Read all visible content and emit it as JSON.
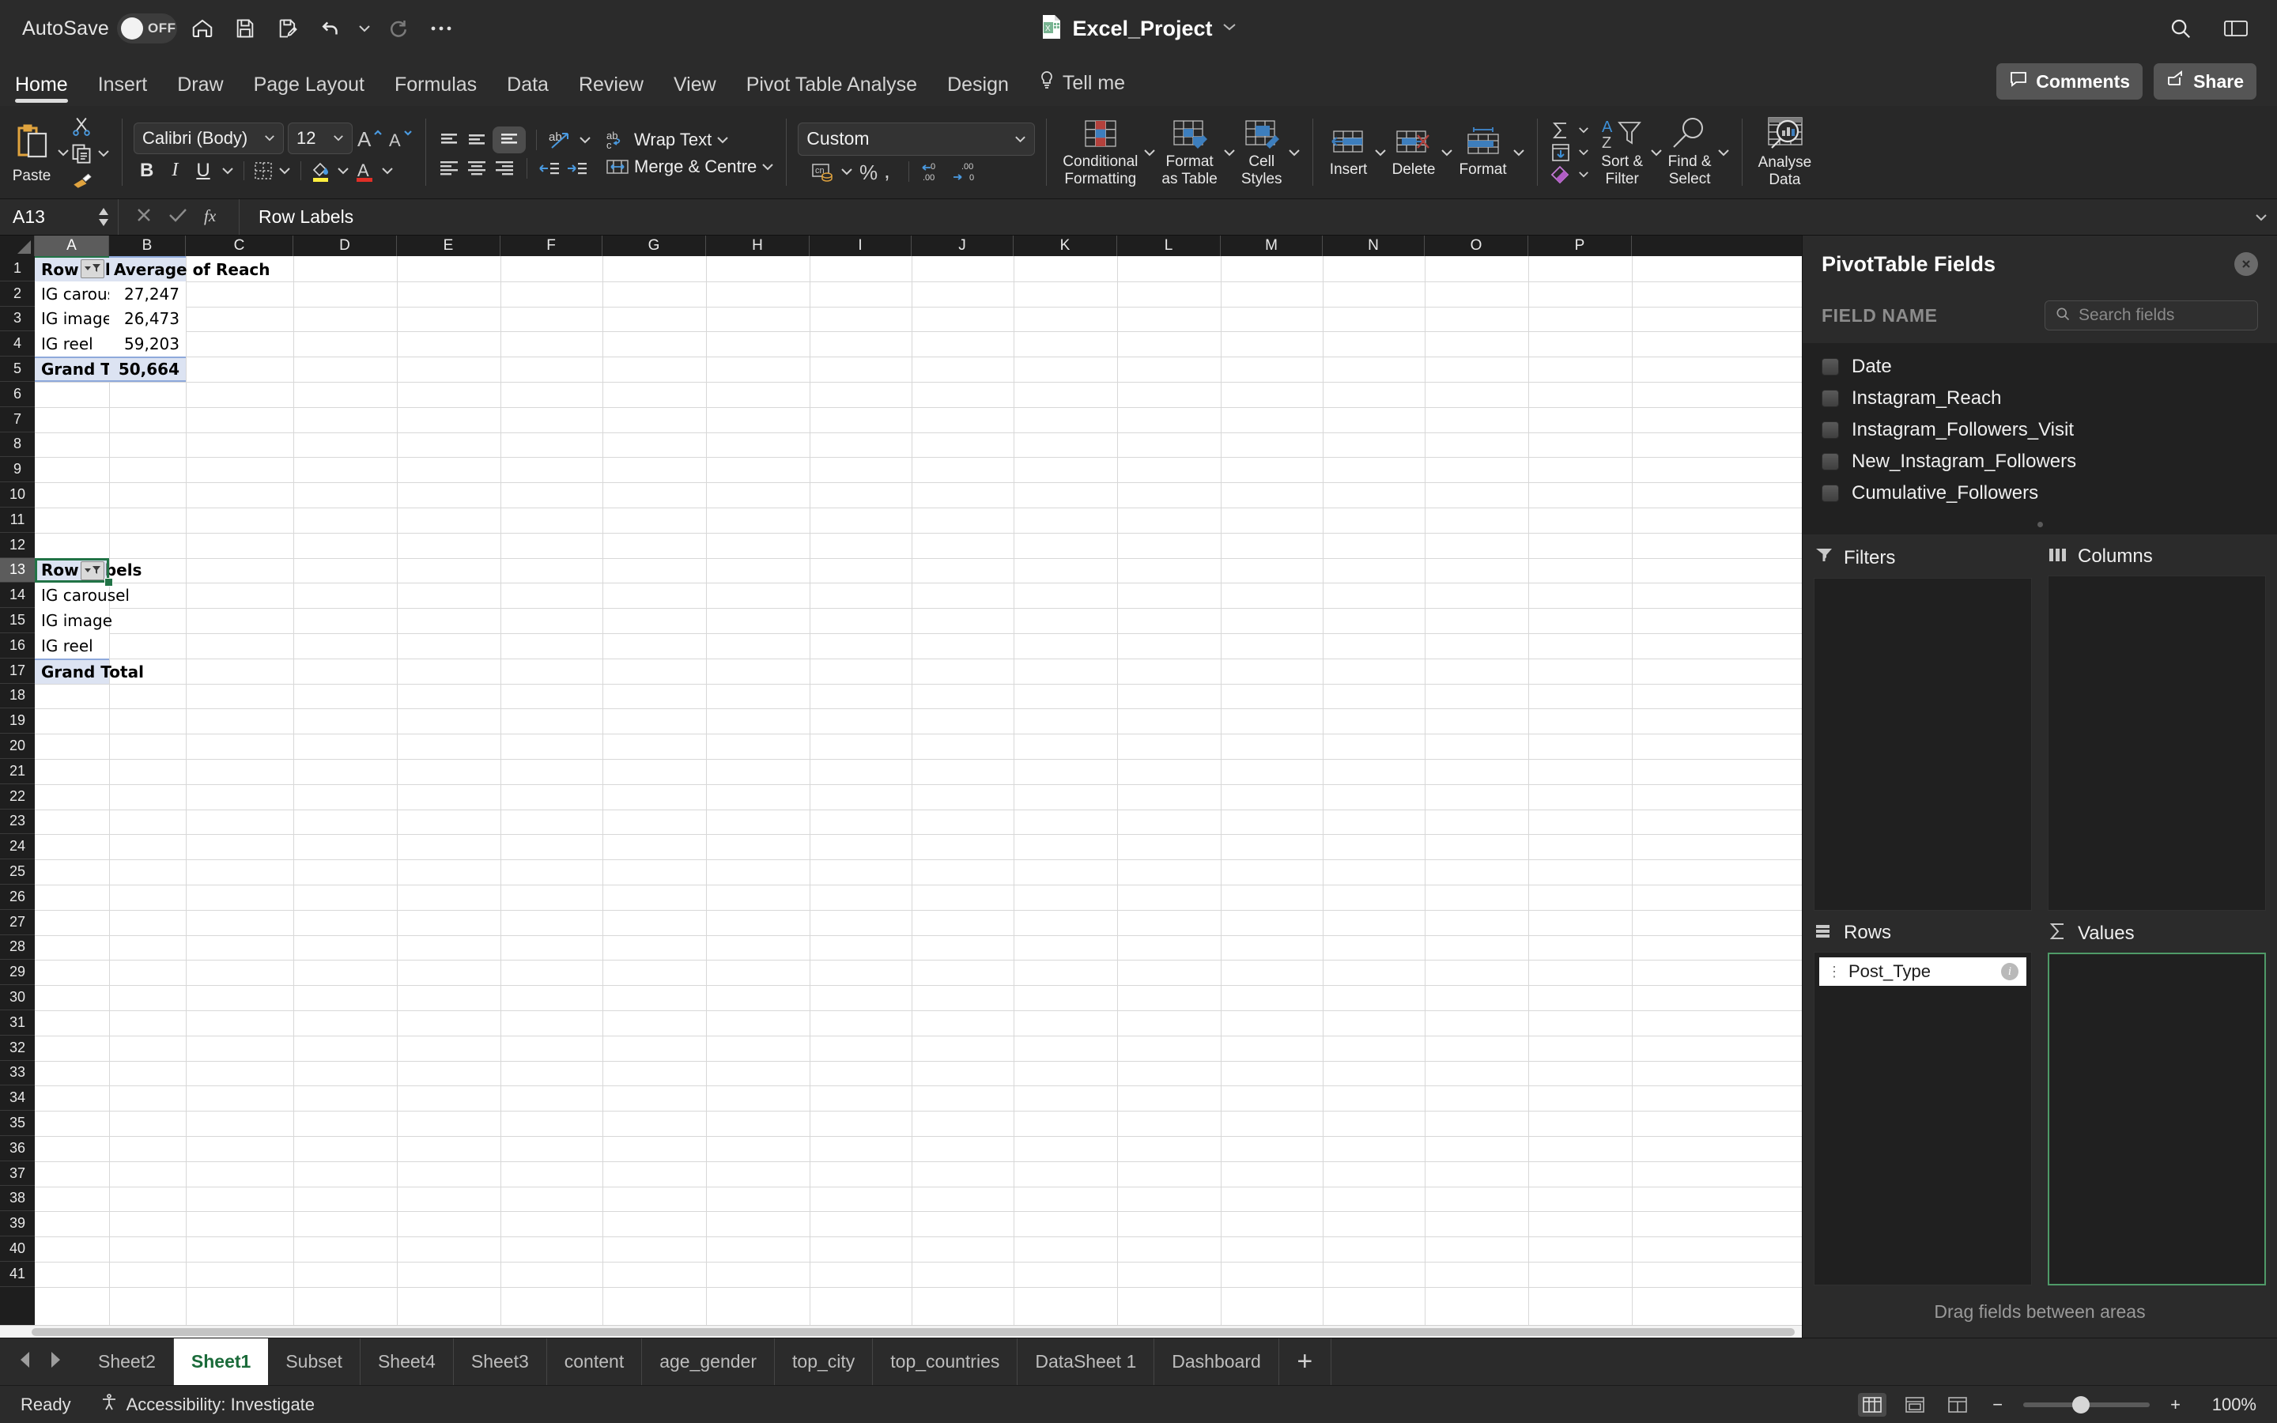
{
  "titlebar": {
    "autosave_label": "AutoSave",
    "autosave_state": "OFF",
    "doc_title": "Excel_Project",
    "icons": [
      "home-icon",
      "save-icon",
      "save-as-icon",
      "undo-icon",
      "redo-icon",
      "more-icon",
      "search-icon",
      "ribbon-display-icon"
    ]
  },
  "tabs": {
    "items": [
      {
        "label": "Home",
        "active": true
      },
      {
        "label": "Insert",
        "active": false
      },
      {
        "label": "Draw",
        "active": false
      },
      {
        "label": "Page Layout",
        "active": false
      },
      {
        "label": "Formulas",
        "active": false
      },
      {
        "label": "Data",
        "active": false
      },
      {
        "label": "Review",
        "active": false
      },
      {
        "label": "View",
        "active": false
      },
      {
        "label": "Pivot Table Analyse",
        "active": false
      },
      {
        "label": "Design",
        "active": false
      },
      {
        "label": "Tell me",
        "active": false
      }
    ],
    "comments_label": "Comments",
    "share_label": "Share"
  },
  "ribbon": {
    "paste_label": "Paste",
    "font_name": "Calibri (Body)",
    "font_size": "12",
    "bold": "B",
    "italic": "I",
    "underline": "U",
    "wrap_text_label": "Wrap Text",
    "merge_label": "Merge & Centre",
    "number_format": "Custom",
    "conditional_formatting": "Conditional\nFormatting",
    "conditional_formatting_l1": "Conditional",
    "conditional_formatting_l2": "Formatting",
    "format_as_table_l1": "Format",
    "format_as_table_l2": "as Table",
    "cell_styles_l1": "Cell",
    "cell_styles_l2": "Styles",
    "insert_label": "Insert",
    "delete_label": "Delete",
    "format_label": "Format",
    "sort_filter_l1": "Sort &",
    "sort_filter_l2": "Filter",
    "find_select_l1": "Find &",
    "find_select_l2": "Select",
    "analyse_data_l1": "Analyse",
    "analyse_data_l2": "Data"
  },
  "formula_bar": {
    "name_box": "A13",
    "formula_value": "Row Labels"
  },
  "grid": {
    "columns": [
      "A",
      "B",
      "C",
      "D",
      "E",
      "F",
      "G",
      "H",
      "I",
      "J",
      "K",
      "L",
      "M",
      "N",
      "O",
      "P"
    ],
    "selected_column": "A",
    "rows": [
      1,
      2,
      3,
      4,
      5,
      6,
      7,
      8,
      9,
      10,
      11,
      12,
      13,
      14,
      15,
      16,
      17,
      18,
      19,
      20,
      21,
      22,
      23,
      24,
      25,
      26,
      27,
      28,
      29,
      30,
      31,
      32,
      33,
      34,
      35,
      36,
      37,
      38,
      39,
      40,
      41
    ],
    "selected_row": 13,
    "pivot_table_1": {
      "header": [
        "Row Labels",
        "Average of Reach"
      ],
      "rows": [
        {
          "label": "IG carousel",
          "value": "27,247"
        },
        {
          "label": "IG image",
          "value": "26,473"
        },
        {
          "label": "IG reel",
          "value": "59,203"
        }
      ],
      "total": {
        "label": "Grand Total",
        "value": "50,664"
      }
    },
    "pivot_table_2": {
      "header": [
        "Row Labels"
      ],
      "rows": [
        {
          "label": "IG carousel"
        },
        {
          "label": "IG image"
        },
        {
          "label": "IG reel"
        }
      ],
      "total": {
        "label": "Grand Total"
      }
    }
  },
  "pivot_panel": {
    "title": "PivotTable Fields",
    "field_name_label": "FIELD NAME",
    "search_placeholder": "Search fields",
    "search_value": "",
    "fields": [
      {
        "label": "Date",
        "checked": false
      },
      {
        "label": "Instagram_Reach",
        "checked": false
      },
      {
        "label": "Instagram_Followers_Visit",
        "checked": false
      },
      {
        "label": "New_Instagram_Followers",
        "checked": false
      },
      {
        "label": "Cumulative_Followers",
        "checked": false
      }
    ],
    "areas": {
      "filters_label": "Filters",
      "columns_label": "Columns",
      "rows_label": "Rows",
      "values_label": "Values",
      "filters_items": [],
      "columns_items": [],
      "rows_items": [
        "Post_Type"
      ],
      "values_items": []
    },
    "footer_hint": "Drag fields between areas"
  },
  "sheet_tabs": {
    "items": [
      {
        "label": "Sheet2",
        "active": false
      },
      {
        "label": "Sheet1",
        "active": true
      },
      {
        "label": "Subset",
        "active": false
      },
      {
        "label": "Sheet4",
        "active": false
      },
      {
        "label": "Sheet3",
        "active": false
      },
      {
        "label": "content",
        "active": false
      },
      {
        "label": "age_gender",
        "active": false
      },
      {
        "label": "top_city",
        "active": false
      },
      {
        "label": "top_countries",
        "active": false
      },
      {
        "label": "DataSheet 1",
        "active": false
      },
      {
        "label": "Dashboard",
        "active": false
      }
    ],
    "add_label": "+"
  },
  "status_bar": {
    "ready_label": "Ready",
    "accessibility_label": "Accessibility: Investigate",
    "zoom_label": "100%"
  },
  "colors": {
    "accent_green": "#217346",
    "pivot_header_bg": "#dce3f2",
    "pivot_border": "#8ea9db",
    "chrome_bg": "#2b2b2b",
    "ribbon_bg": "#282828"
  }
}
